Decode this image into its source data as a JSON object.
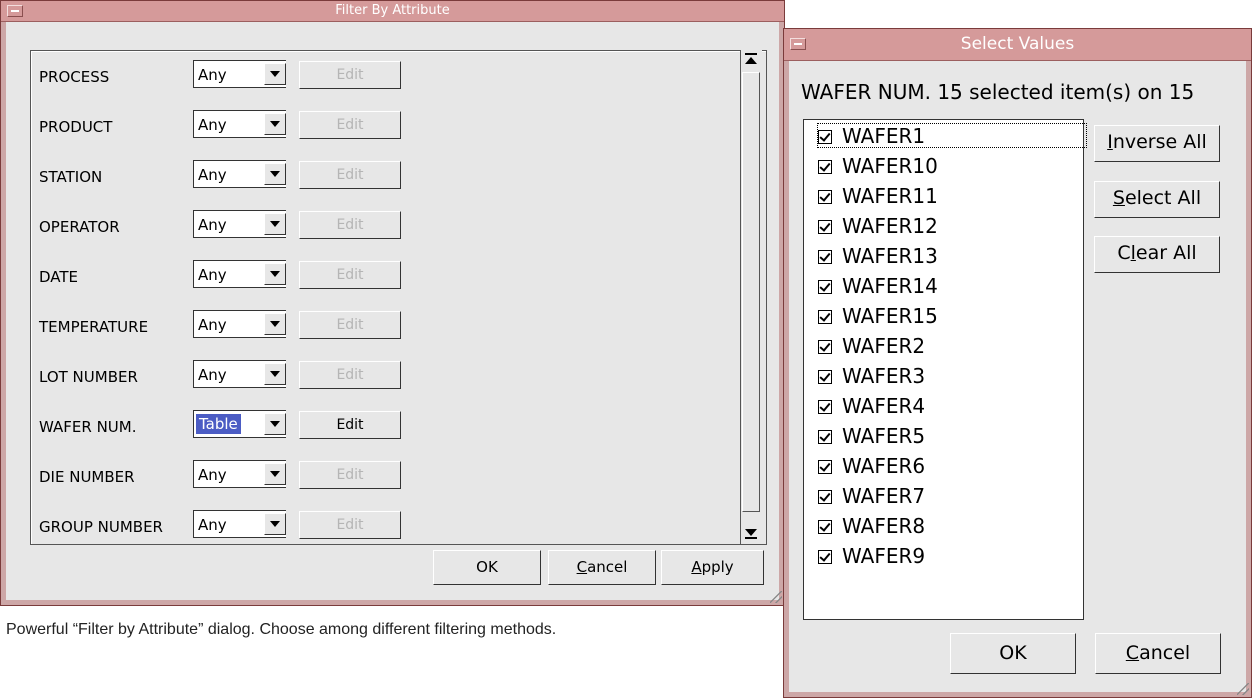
{
  "filter_window": {
    "title": "Filter By Attribute",
    "rows": [
      {
        "label": "PROCESS",
        "value": "Any",
        "edit": "Edit",
        "edit_enabled": false
      },
      {
        "label": "PRODUCT",
        "value": "Any",
        "edit": "Edit",
        "edit_enabled": false
      },
      {
        "label": "STATION",
        "value": "Any",
        "edit": "Edit",
        "edit_enabled": false
      },
      {
        "label": "OPERATOR",
        "value": "Any",
        "edit": "Edit",
        "edit_enabled": false
      },
      {
        "label": "DATE",
        "value": "Any",
        "edit": "Edit",
        "edit_enabled": false
      },
      {
        "label": "TEMPERATURE",
        "value": "Any",
        "edit": "Edit",
        "edit_enabled": false
      },
      {
        "label": "LOT NUMBER",
        "value": "Any",
        "edit": "Edit",
        "edit_enabled": false
      },
      {
        "label": "WAFER NUM.",
        "value": "Table",
        "edit": "Edit",
        "edit_enabled": true
      },
      {
        "label": "DIE NUMBER",
        "value": "Any",
        "edit": "Edit",
        "edit_enabled": false
      },
      {
        "label": "GROUP NUMBER",
        "value": "Any",
        "edit": "Edit",
        "edit_enabled": false
      }
    ],
    "buttons": {
      "ok": "OK",
      "cancel": "Cancel",
      "apply": "Apply"
    }
  },
  "caption": "Powerful “Filter by Attribute” dialog. Choose among different filtering methods.",
  "select_window": {
    "title": "Select Values",
    "header": "WAFER NUM.  15 selected item(s) on 15",
    "items": [
      "WAFER1",
      "WAFER10",
      "WAFER11",
      "WAFER12",
      "WAFER13",
      "WAFER14",
      "WAFER15",
      "WAFER2",
      "WAFER3",
      "WAFER4",
      "WAFER5",
      "WAFER6",
      "WAFER7",
      "WAFER8",
      "WAFER9"
    ],
    "buttons": {
      "inverse_all": "Inverse All",
      "select_all": "Select All",
      "clear_all": "Clear All",
      "ok": "OK",
      "cancel": "Cancel"
    }
  },
  "colors": {
    "title_bar": "#d59a9a",
    "selection": "#4b5cc4",
    "window_bg": "#e7e7e7"
  }
}
